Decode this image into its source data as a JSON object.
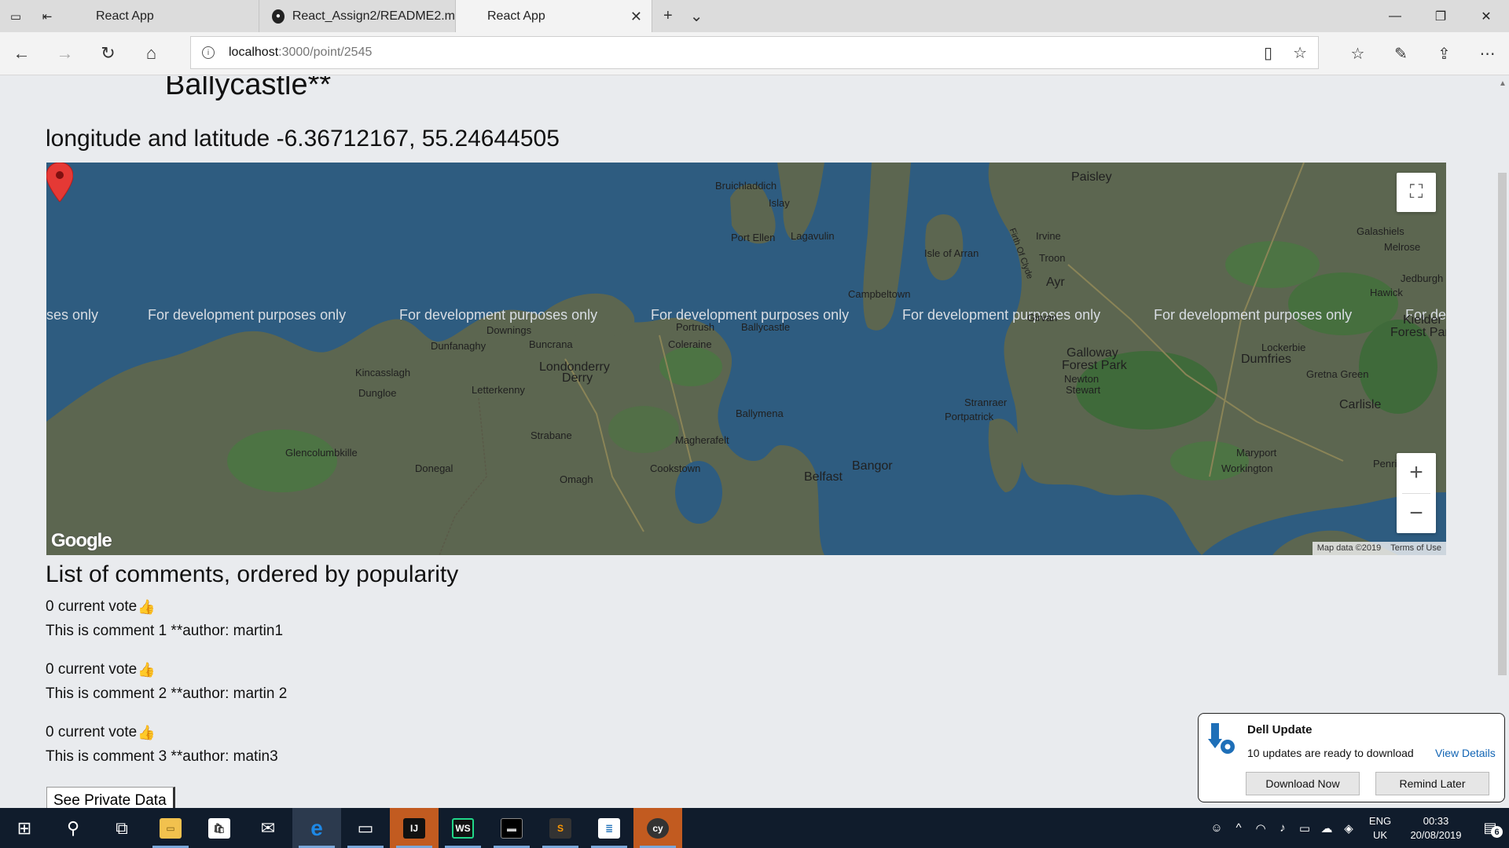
{
  "browser": {
    "tabs": [
      {
        "title": "React App"
      },
      {
        "title": "React_Assign2/README2.m"
      },
      {
        "title": "React App"
      }
    ],
    "address": {
      "host": "localhost",
      "path": ":3000/point/2545"
    }
  },
  "page": {
    "place_title": "Ballycastle**",
    "coords_label": "longitude and latitude",
    "coords_value": "-6.36712167, 55.24644505",
    "comments_heading": "List of comments, ordered by popularity",
    "comments": [
      {
        "votes": "0 current vote",
        "text": "This is comment 1 **author: martin1"
      },
      {
        "votes": "0 current vote",
        "text": "This is comment 2 **author: martin 2"
      },
      {
        "votes": "0 current vote",
        "text": "This is comment 3 **author: matin3"
      }
    ],
    "private_button": "See Private Data"
  },
  "map": {
    "dev_notice": "For development purposes only",
    "dev_notice_partial_left": "ses only",
    "dev_notice_partial_right": "For de",
    "attribution": "Map data ©2019",
    "terms": "Terms of Use",
    "logo": "Google",
    "labels": {
      "paisley": "Paisley",
      "bruichladdich": "Bruichladdich",
      "islay": "Islay",
      "port_ellen": "Port Ellen",
      "lagavulin": "Lagavulin",
      "isle_of_arran": "Isle of Arran",
      "irvine": "Irvine",
      "troon": "Troon",
      "ayr": "Ayr",
      "campbeltown": "Campbeltown",
      "galashiels": "Galashiels",
      "melrose": "Melrose",
      "jedburgh": "Jedburgh",
      "hawick": "Hawick",
      "kielder": "Kielder",
      "forest_park": "Forest Park",
      "girvan": "Girvan",
      "portrush": "Portrush",
      "ballycastle": "Ballycastle",
      "coleraine": "Coleraine",
      "downings": "Downings",
      "dunfanaghy": "Dunfanaghy",
      "buncrana": "Buncrana",
      "londonderry": "Londonderry",
      "derry": "Derry",
      "kincasslagh": "Kincasslagh",
      "dungloe": "Dungloe",
      "letterkenny": "Letterkenny",
      "galloway": "Galloway",
      "galloway_fp": "Forest Park",
      "dumfries": "Dumfries",
      "lockerbie": "Lockerbie",
      "newton_stewart": "Newton",
      "newton_stewart2": "Stewart",
      "gretna": "Gretna Green",
      "carlisle": "Carlisle",
      "stranraer": "Stranraer",
      "portpatrick": "Portpatrick",
      "ballymena": "Ballymena",
      "strabane": "Strabane",
      "magherafelt": "Magherafelt",
      "glencolumbkille": "Glencolumbkille",
      "donegal": "Donegal",
      "omagh": "Omagh",
      "cookstown": "Cookstown",
      "belfast": "Belfast",
      "bangor": "Bangor",
      "maryport": "Maryport",
      "workington": "Workington",
      "penrith": "Penrith",
      "firth_of_clyde": "Firth Of Clyde"
    }
  },
  "toast": {
    "title": "Dell Update",
    "message": "10 updates are ready to download",
    "link": "View Details",
    "primary": "Download Now",
    "secondary": "Remind Later"
  },
  "taskbar": {
    "lang_line1": "ENG",
    "lang_line2": "UK",
    "time": "00:33",
    "date": "20/08/2019",
    "notification_count": "6",
    "apps": [
      "IJ",
      "WS",
      "cy"
    ]
  },
  "colors": {
    "sea": "#2e5c80",
    "land": "#5c6650",
    "taskbar": "#101c2c",
    "edge_blue": "#1e88e5",
    "pin_red": "#e53935"
  }
}
